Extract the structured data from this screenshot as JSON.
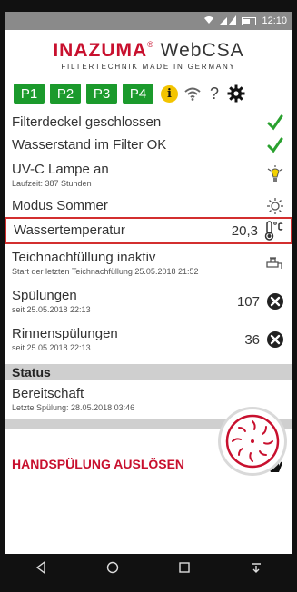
{
  "statusbar": {
    "time": "12:10",
    "signal_icon": "wifi-icon",
    "cell_icon": "cell-signal-icon",
    "battery_icon": "battery-icon"
  },
  "logo": {
    "brand": "INAZUMA",
    "product": "WebCSA",
    "tagline": "FILTERTECHNIK MADE IN GERMANY"
  },
  "toolbar": {
    "programs": [
      "P1",
      "P2",
      "P3",
      "P4"
    ],
    "info": "i",
    "help": "?"
  },
  "items": [
    {
      "label": "Filterdeckel geschlossen",
      "icon": "check-icon"
    },
    {
      "label": "Wasserstand im Filter OK",
      "icon": "check-icon"
    },
    {
      "label": "UV-C Lampe an",
      "sub": "Laufzeit: 387 Stunden",
      "icon": "lamp-icon"
    },
    {
      "label": "Modus Sommer",
      "icon": "sun-icon"
    },
    {
      "label": "Wassertemperatur",
      "value": "20,3",
      "icon": "thermometer-icon"
    },
    {
      "label": "Teichnachfüllung inaktiv",
      "sub": "Start der letzten Teichnachfüllung 25.05.2018 21:52",
      "icon": "faucet-icon"
    },
    {
      "label": "Spülungen",
      "sub": "seit 25.05.2018 22:13",
      "value": "107",
      "icon": "reset-icon"
    },
    {
      "label": "Rinnenspülungen",
      "sub": "seit 25.05.2018 22:13",
      "value": "36",
      "icon": "reset-icon"
    }
  ],
  "status": {
    "header": "Status",
    "state": "Bereitschaft",
    "last": "Letzte Spülung: 28.05.2018 03:46"
  },
  "flush": {
    "label": "HANDSPÜLUNG AUSLÖSEN",
    "icon": "hand-icon"
  },
  "colors": {
    "accent": "#c8102e",
    "green": "#1b9a2c",
    "check": "#2aa12f"
  }
}
